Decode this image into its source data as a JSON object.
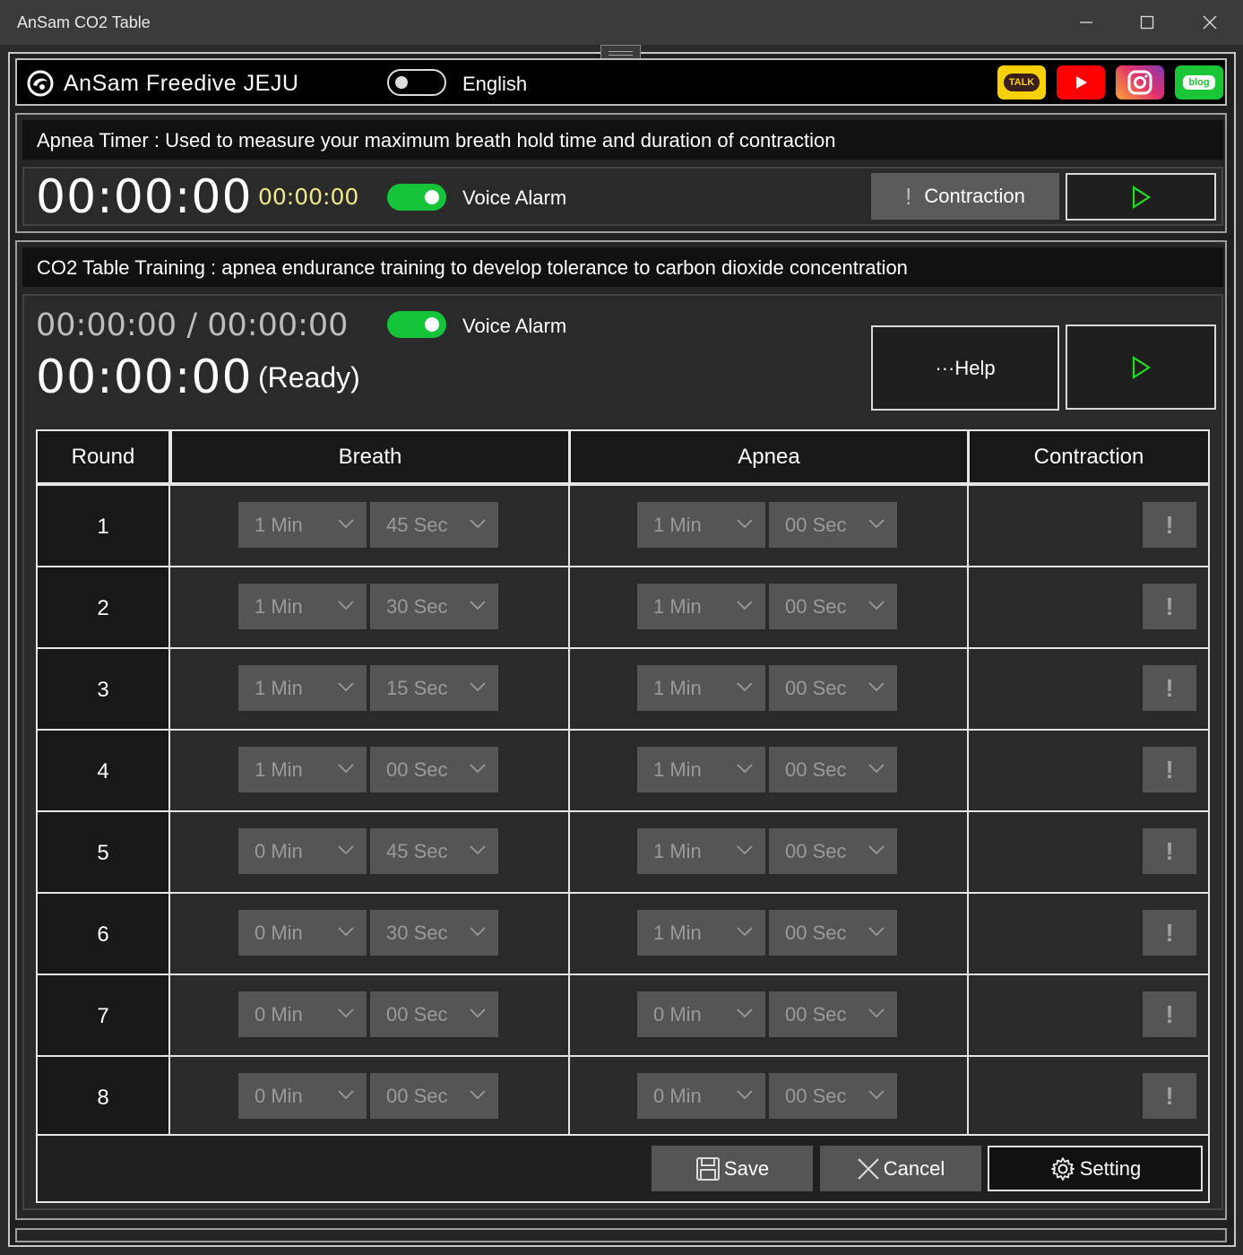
{
  "window": {
    "title": "AnSam CO2 Table"
  },
  "header": {
    "app_name": "AnSam Freedive JEJU",
    "language": "English"
  },
  "social": {
    "talk": "TALK",
    "blog": "blog"
  },
  "apnea_timer": {
    "title": "Apnea Timer : Used to measure your maximum breath hold time and duration of contraction",
    "main_time": "00:00:00",
    "contraction_time": "00:00:00",
    "voice_alarm": "Voice Alarm",
    "contraction_label": "Contraction",
    "contraction_icon": "!"
  },
  "co2": {
    "title": "CO2 Table Training : apnea endurance training to develop tolerance to carbon dioxide concentration",
    "progress": "00:00:00 / 00:00:00",
    "main_time": "00:00:00",
    "status": "(Ready)",
    "voice_alarm": "Voice Alarm",
    "help_label": "···Help"
  },
  "table": {
    "headers": {
      "round": "Round",
      "breath": "Breath",
      "apnea": "Apnea",
      "contraction": "Contraction"
    },
    "rows": [
      {
        "round": "1",
        "breath_min": "1 Min",
        "breath_sec": "45 Sec",
        "apnea_min": "1 Min",
        "apnea_sec": "00 Sec",
        "contraction": "!"
      },
      {
        "round": "2",
        "breath_min": "1 Min",
        "breath_sec": "30 Sec",
        "apnea_min": "1 Min",
        "apnea_sec": "00 Sec",
        "contraction": "!"
      },
      {
        "round": "3",
        "breath_min": "1 Min",
        "breath_sec": "15 Sec",
        "apnea_min": "1 Min",
        "apnea_sec": "00 Sec",
        "contraction": "!"
      },
      {
        "round": "4",
        "breath_min": "1 Min",
        "breath_sec": "00 Sec",
        "apnea_min": "1 Min",
        "apnea_sec": "00 Sec",
        "contraction": "!"
      },
      {
        "round": "5",
        "breath_min": "0 Min",
        "breath_sec": "45 Sec",
        "apnea_min": "1 Min",
        "apnea_sec": "00 Sec",
        "contraction": "!"
      },
      {
        "round": "6",
        "breath_min": "0 Min",
        "breath_sec": "30 Sec",
        "apnea_min": "1 Min",
        "apnea_sec": "00 Sec",
        "contraction": "!"
      },
      {
        "round": "7",
        "breath_min": "0 Min",
        "breath_sec": "00 Sec",
        "apnea_min": "0 Min",
        "apnea_sec": "00 Sec",
        "contraction": "!"
      },
      {
        "round": "8",
        "breath_min": "0 Min",
        "breath_sec": "00 Sec",
        "apnea_min": "0 Min",
        "apnea_sec": "00 Sec",
        "contraction": "!"
      }
    ]
  },
  "footer": {
    "save": "Save",
    "cancel": "Cancel",
    "setting": "Setting"
  },
  "colors": {
    "accent_green": "#16c43a",
    "play_green": "#22dd22",
    "time_yellow": "#f0e68c"
  },
  "icons": [
    "app-logo-icon",
    "minimize-icon",
    "maximize-icon",
    "close-icon",
    "kakaotalk-icon",
    "youtube-icon",
    "instagram-icon",
    "blog-icon",
    "play-icon",
    "chevron-down-icon",
    "save-icon",
    "cancel-icon",
    "gear-icon",
    "exclamation-icon"
  ]
}
